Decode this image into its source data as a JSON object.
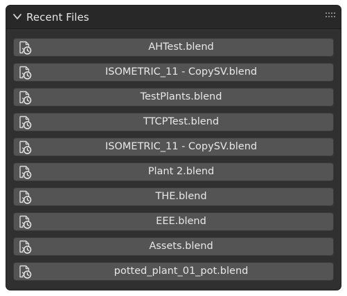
{
  "panel": {
    "title": "Recent Files",
    "collapse_icon": "chevron-down-icon",
    "drag_icon": "grip-dots-icon"
  },
  "files": [
    {
      "name": "AHTest.blend",
      "icon": "open-recent-file-icon"
    },
    {
      "name": "ISOMETRIC_11 - CopySV.blend",
      "icon": "open-recent-file-icon"
    },
    {
      "name": "TestPlants.blend",
      "icon": "open-recent-file-icon"
    },
    {
      "name": "TTCPTest.blend",
      "icon": "open-recent-file-icon"
    },
    {
      "name": "ISOMETRIC_11 - CopySV.blend",
      "icon": "open-recent-file-icon"
    },
    {
      "name": "Plant 2.blend",
      "icon": "open-recent-file-icon"
    },
    {
      "name": "THE.blend",
      "icon": "open-recent-file-icon"
    },
    {
      "name": "EEE.blend",
      "icon": "open-recent-file-icon"
    },
    {
      "name": "Assets.blend",
      "icon": "open-recent-file-icon"
    },
    {
      "name": "potted_plant_01_pot.blend",
      "icon": "open-recent-file-icon"
    }
  ],
  "colors": {
    "panel_bg": "#303030",
    "header_bg": "#282828",
    "button_bg": "#545454",
    "text": "#e8e8e8"
  }
}
